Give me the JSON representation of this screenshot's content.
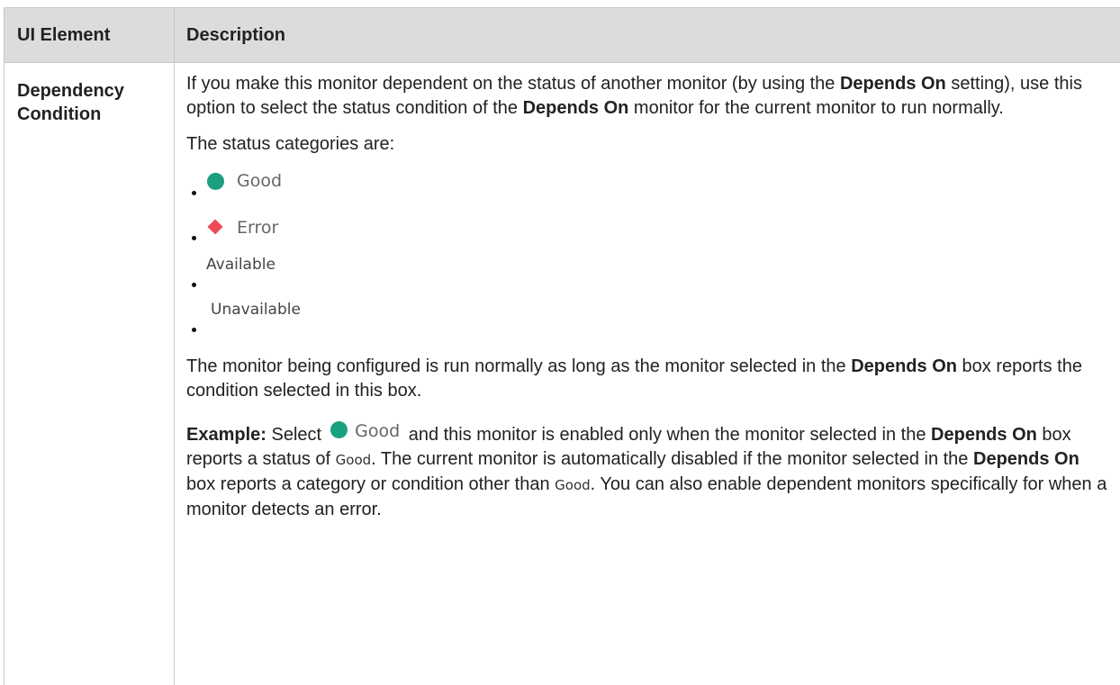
{
  "table": {
    "headers": {
      "col1": "UI Element",
      "col2": "Description"
    },
    "row": {
      "term_line1": "Dependency",
      "term_line2": "Condition",
      "para1": {
        "t1": "If you make this monitor dependent on the status of another monitor (by using the ",
        "b1": "Depends On",
        "t2": " setting), use this option to select the status condition of the ",
        "b2": "Depends On",
        "t3": " monitor for the current monitor to run normally."
      },
      "para2": "The status categories are:",
      "statuses": [
        {
          "label": "Good",
          "icon": "green-circle-icon",
          "color": "#1aa07f"
        },
        {
          "label": "Error",
          "icon": "red-diamond-icon",
          "color": "#f04a57"
        },
        {
          "label": "Available",
          "icon": ""
        },
        {
          "label": "Unavailable",
          "icon": ""
        }
      ],
      "para3": {
        "t1": "The monitor being configured is run normally as long as the monitor selected in the ",
        "b1": "Depends On",
        "t2": " box reports the condition selected in this box."
      },
      "example": {
        "label": "Example:",
        "t1": " Select",
        "icon_label": "Good",
        "t2": " and this monitor is enabled only when the monitor selected in the ",
        "b1": "Depends On",
        "t3": " box reports a status of ",
        "code1": "Good",
        "t4": ". The current monitor is automatically disabled if the monitor selected in the ",
        "b2": "Depends On",
        "t5": " box reports a category or condition other than ",
        "code2": "Good",
        "t6": ". You can also enable dependent monitors specifically for when a monitor detects an error."
      }
    }
  }
}
